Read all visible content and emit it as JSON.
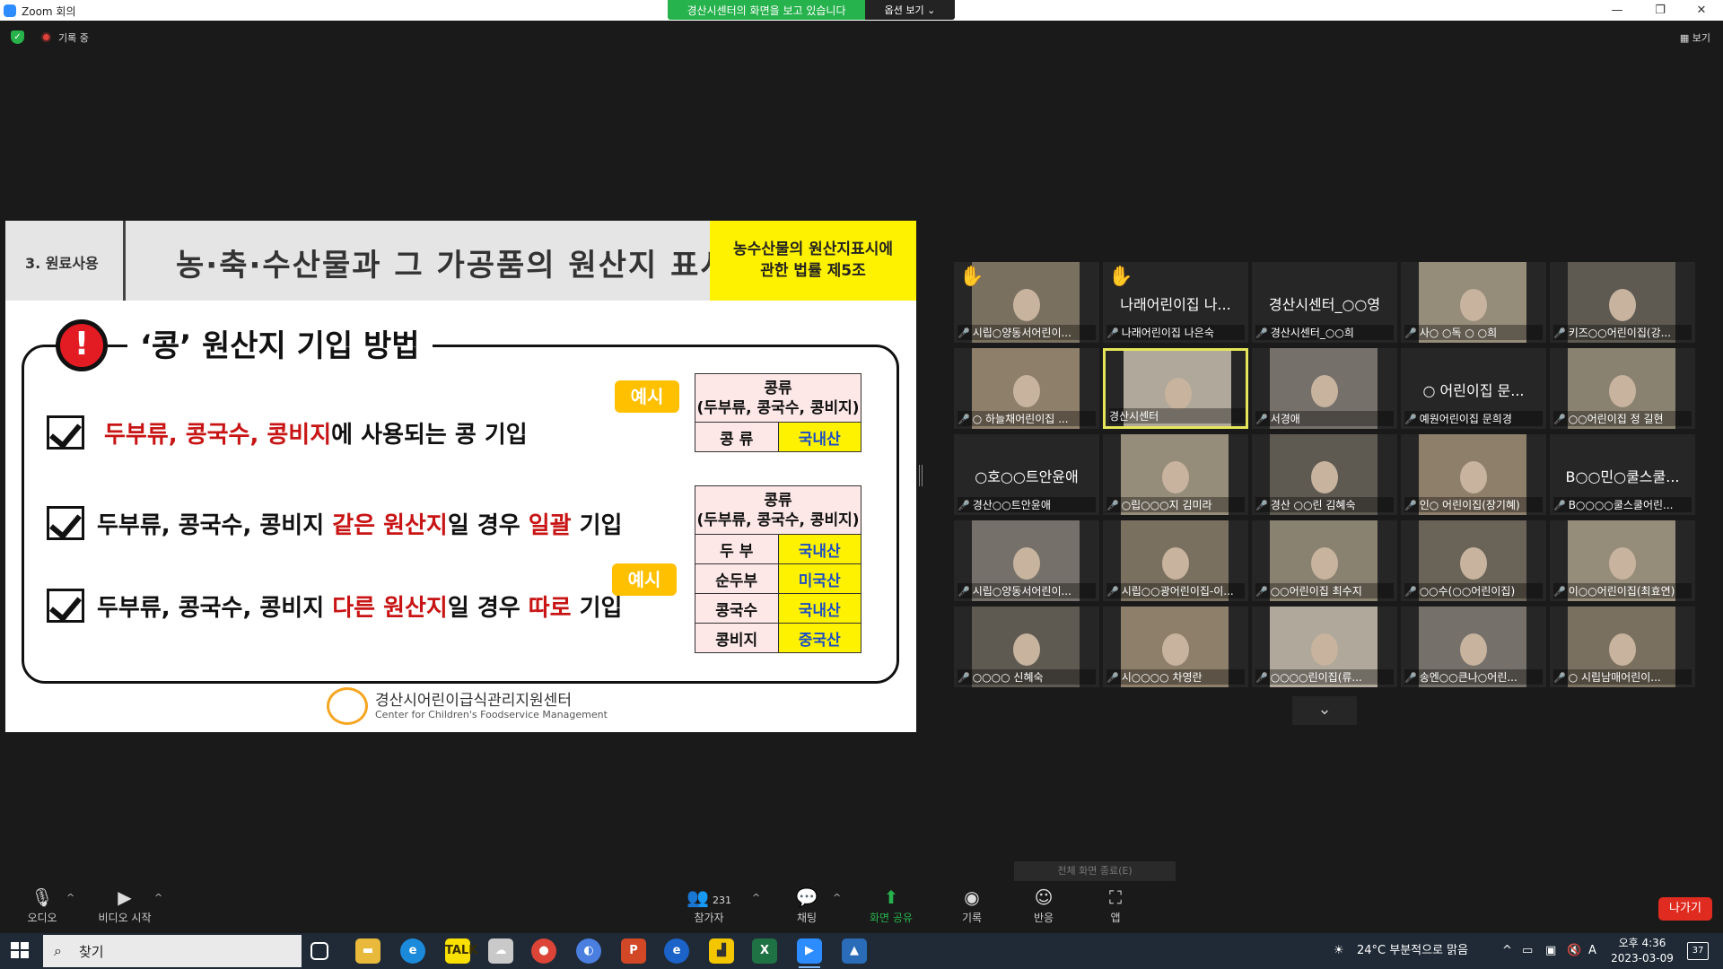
{
  "window": {
    "title": "Zoom 회의"
  },
  "share_banner": {
    "text": "경산시센터의 화면을 보고 있습니다",
    "view_options": "옵션 보기 ⌄"
  },
  "status": {
    "recording": "기록 중",
    "view": "보기"
  },
  "slide": {
    "section": "3. 원료사용",
    "title": "농·축·수산물과 그 가공품의 원산지 표시",
    "law": [
      "농수산물의 원산지표시에",
      "관한 법률 제5조"
    ],
    "subtitle": "‘콩’ 원산지 기입 방법",
    "items": [
      {
        "red": "두부류, 콩국수, 콩비지",
        "black": "에 사용되는 콩 기입"
      },
      {
        "a": "두부류, 콩국수, 콩비지 ",
        "red1": "같은 원산지",
        "b": "일 경우 ",
        "red2": "일괄",
        "c": " 기입"
      },
      {
        "a": "두부류, 콩국수, 콩비지 ",
        "red1": "다른 원산지",
        "b": "일 경우 ",
        "red2": "따로",
        "c": " 기입"
      }
    ],
    "example_label": "예시",
    "table1": {
      "header": [
        "콩류",
        "(두부류, 콩국수, 콩비지)"
      ],
      "rows": [
        {
          "label": "콩 류",
          "value": "국내산"
        }
      ]
    },
    "table2": {
      "header": [
        "콩류",
        "(두부류, 콩국수, 콩비지)"
      ],
      "rows": [
        {
          "label": "두 부",
          "value": "국내산"
        },
        {
          "label": "순두부",
          "value": "미국산"
        },
        {
          "label": "콩국수",
          "value": "국내산"
        },
        {
          "label": "콩비지",
          "value": "중국산"
        }
      ]
    },
    "logo": {
      "name": "경산시어린이급식관리지원센터",
      "sub": "Center for Children's Foodservice Management"
    }
  },
  "participants": [
    {
      "name": "시립○양동서어린이...",
      "hand": true
    },
    {
      "name": "나래어린이집 나은숙",
      "big": "나래어린이집 나...",
      "hand": true
    },
    {
      "name": "경산시센터_○○희",
      "big": "경산시센터_○○영"
    },
    {
      "name": "사○ ○독 ○ ○희"
    },
    {
      "name": "키즈○○어린이집(강..."
    },
    {
      "name": "○ 하늘채어린이집 ..."
    },
    {
      "name": "경산시센터",
      "active": true
    },
    {
      "name": "서경애"
    },
    {
      "name": "예원어린이집 문희경",
      "big": "○ 어린이집 문..."
    },
    {
      "name": "○○어린이집 정 길현"
    },
    {
      "name": "경산○○트안윤애",
      "big": "○호○○트안윤애"
    },
    {
      "name": "○립○○○지 김미라"
    },
    {
      "name": "경산 ○○린 김혜숙"
    },
    {
      "name": "인○ 어린이집(장기혜)"
    },
    {
      "name": "B○○○○쿨스쿨어린...",
      "big": "B○○민○쿨스쿨..."
    },
    {
      "name": "시립○양동서어린이..."
    },
    {
      "name": "시립○○광어린이집-이..."
    },
    {
      "name": "○○어린이집 최수지"
    },
    {
      "name": "○○수(○○어린이집)"
    },
    {
      "name": "이○○어린이집(최효연)"
    },
    {
      "name": "○○○○ 신혜숙"
    },
    {
      "name": "시○○○○ 차영란"
    },
    {
      "name": "○○○○린이집(류..."
    },
    {
      "name": "송엔○○큰나○어린..."
    },
    {
      "name": "○ 시립남매어린이..."
    }
  ],
  "toolbar": {
    "audio": "오디오",
    "video": "비디오 시작",
    "participants": "참가자",
    "participant_count": "231",
    "chat": "채팅",
    "share": "화면 공유",
    "record": "기록",
    "reactions": "반응",
    "apps": "앱",
    "leave": "나가기",
    "fullscreen": "전체 화면 종료(E)"
  },
  "taskbar": {
    "search": "찾기",
    "weather": "24°C  부분적으로 맑음",
    "time": "오후 4:36",
    "date": "2023-03-09",
    "ime": "A",
    "notifications": "37"
  },
  "colors": {
    "zoom_green": "#26b24c",
    "zoom_blue": "#2d8cff",
    "leave_red": "#e02b20",
    "highlight_yellow": "#fff200",
    "slide_red": "#c81414"
  }
}
